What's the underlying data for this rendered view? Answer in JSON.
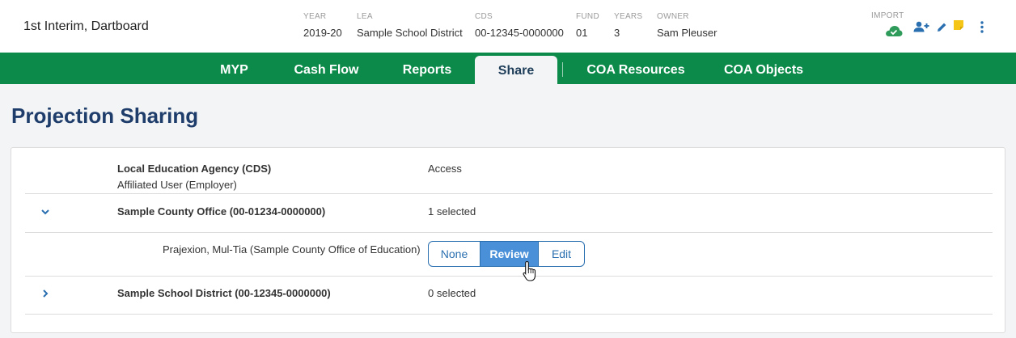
{
  "header": {
    "project_name": "1st Interim, Dartboard",
    "meta": [
      {
        "label": "YEAR",
        "value": "2019-20"
      },
      {
        "label": "LEA",
        "value": "Sample School District"
      },
      {
        "label": "CDS",
        "value": "00-12345-0000000"
      },
      {
        "label": "FUND",
        "value": "01"
      },
      {
        "label": "YEARS",
        "value": "3"
      },
      {
        "label": "OWNER",
        "value": "Sam Pleuser"
      }
    ],
    "import_label": "IMPORT",
    "icons": [
      "cloud-check-icon",
      "add-user-icon",
      "pencil-icon",
      "sticky-note-icon",
      "more-vertical-icon"
    ]
  },
  "nav": {
    "tabs": [
      {
        "label": "MYP",
        "active": false
      },
      {
        "label": "Cash Flow",
        "active": false
      },
      {
        "label": "Reports",
        "active": false
      },
      {
        "label": "Share",
        "active": true
      },
      {
        "label": "COA Resources",
        "active": false
      },
      {
        "label": "COA Objects",
        "active": false
      }
    ]
  },
  "page": {
    "title": "Projection Sharing"
  },
  "sharing": {
    "header_col1_line1": "Local Education Agency (CDS)",
    "header_col1_line2": "Affiliated User (Employer)",
    "header_col2": "Access",
    "groups": [
      {
        "name": "Sample County Office (00-01234-0000000)",
        "status": "1 selected",
        "expanded": true,
        "users": [
          {
            "name": "Prajexion, Mul-Tia (Sample County Office of Education)",
            "access_options": [
              "None",
              "Review",
              "Edit"
            ],
            "selected": "Review"
          }
        ]
      },
      {
        "name": "Sample School District (00-12345-0000000)",
        "status": "0 selected",
        "expanded": false,
        "users": []
      }
    ]
  },
  "colors": {
    "nav_green": "#0b8a4a",
    "title_blue": "#1e3d6b",
    "accent_blue": "#2a6fb0",
    "selected_blue": "#4a90d9",
    "import_green": "#2e9b5a",
    "note_yellow": "#f5c518"
  }
}
